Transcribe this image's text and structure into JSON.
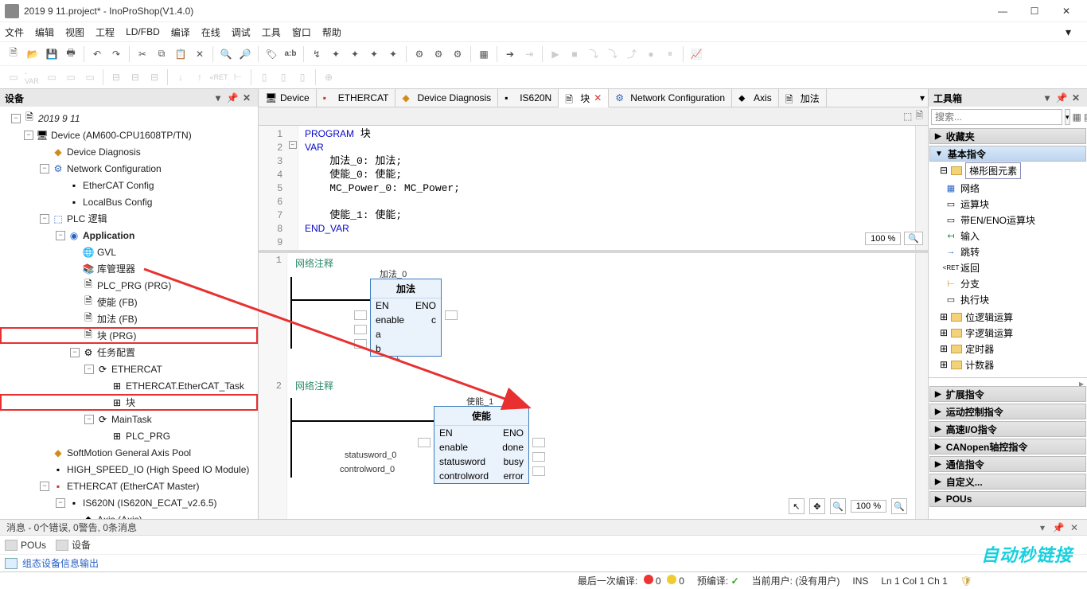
{
  "window": {
    "title": "2019 9 11.project* - InoProShop(V1.4.0)"
  },
  "menu": [
    "文件",
    "编辑",
    "视图",
    "工程",
    "LD/FBD",
    "编译",
    "在线",
    "调试",
    "工具",
    "窗口",
    "帮助"
  ],
  "left_panel": {
    "title": "设备",
    "tree": {
      "root": "2019 9 11",
      "device": "Device (AM600-CPU1608TP/TN)",
      "diag": "Device Diagnosis",
      "netconf": "Network Configuration",
      "ethercat_cfg": "EtherCAT Config",
      "localbus_cfg": "LocalBus Config",
      "plc_logic": "PLC 逻辑",
      "application": "Application",
      "gvl": "GVL",
      "libmgr": "库管理器",
      "plc_prg": "PLC_PRG (PRG)",
      "shineng_fb": "使能 (FB)",
      "jiafa_fb": "加法 (FB)",
      "kuai_prg": "块 (PRG)",
      "task_cfg": "任务配置",
      "ethercat_task_group": "ETHERCAT",
      "ethercat_task": "ETHERCAT.EtherCAT_Task",
      "kuai_task": "块",
      "maintask": "MainTask",
      "plc_prg_task": "PLC_PRG",
      "softmotion": "SoftMotion General Axis Pool",
      "highspeed": "HIGH_SPEED_IO (High Speed IO Module)",
      "ethercat_master": "ETHERCAT (EtherCAT Master)",
      "is620n": "IS620N (IS620N_ECAT_v2.6.5)",
      "axis": "Axis (Axis)"
    }
  },
  "tabs": [
    {
      "label": "Device"
    },
    {
      "label": "ETHERCAT"
    },
    {
      "label": "Device Diagnosis"
    },
    {
      "label": "IS620N"
    },
    {
      "label": "块",
      "active": true,
      "closable": true
    },
    {
      "label": "Network Configuration"
    },
    {
      "label": "Axis"
    },
    {
      "label": "加法"
    }
  ],
  "code": {
    "lines": [
      "PROGRAM 块",
      "VAR",
      "    加法_0: 加法;",
      "    使能_0: 使能;",
      "    MC_Power_0: MC_Power;",
      "",
      "    使能_1: 使能;",
      "END_VAR",
      ""
    ],
    "zoom": "100 %"
  },
  "ladder": {
    "net1_label": "网络注释",
    "block1_instance": "加法_0",
    "block1_title": "加法",
    "block1_ports": [
      {
        "l": "EN",
        "r": "ENO"
      },
      {
        "l": "enable",
        "r": "c"
      },
      {
        "l": "a",
        "r": ""
      },
      {
        "l": "b",
        "r": ""
      }
    ],
    "net2_label": "网络注释",
    "block2_instance": "使能_1",
    "block2_title": "使能",
    "block2_ports": [
      {
        "l": "EN",
        "r": "ENO"
      },
      {
        "l": "enable",
        "r": "done"
      },
      {
        "l": "statusword",
        "r": "busy"
      },
      {
        "l": "controlword",
        "r": "error"
      }
    ],
    "sig_statusword": "statusword_0",
    "sig_controlword": "controlword_0",
    "zoom": "100 %"
  },
  "toolbox": {
    "title": "工具箱",
    "search_placeholder": "搜索...",
    "fav": "收藏夹",
    "basic": "基本指令",
    "ladder_elements": "梯形图元素",
    "items": [
      "网络",
      "运算块",
      "带EN/ENO运算块",
      "输入",
      "跳转",
      "返回",
      "分支",
      "执行块"
    ],
    "folders": [
      "位逻辑运算",
      "字逻辑运算",
      "定时器",
      "计数器"
    ],
    "cats": [
      "扩展指令",
      "运动控制指令",
      "高速I/O指令",
      "CANopen轴控指令",
      "通信指令",
      "自定义...",
      "POUs"
    ]
  },
  "messages": {
    "text": "消息 - 0个错误, 0警告, 0条消息"
  },
  "bottom_tabs": {
    "pous": "POUs",
    "devices": "设备"
  },
  "config_out": "组态设备信息输出",
  "statusbar": {
    "lastcompile": "最后一次编译:",
    "errcount": "0",
    "warncount": "0",
    "precompile": "预编译:",
    "curuser_label": "当前用户:",
    "curuser": "(没有用户)",
    "insmode": "INS",
    "pos": "Ln 1  Col 1  Ch 1"
  },
  "watermark": "自动秒链接"
}
